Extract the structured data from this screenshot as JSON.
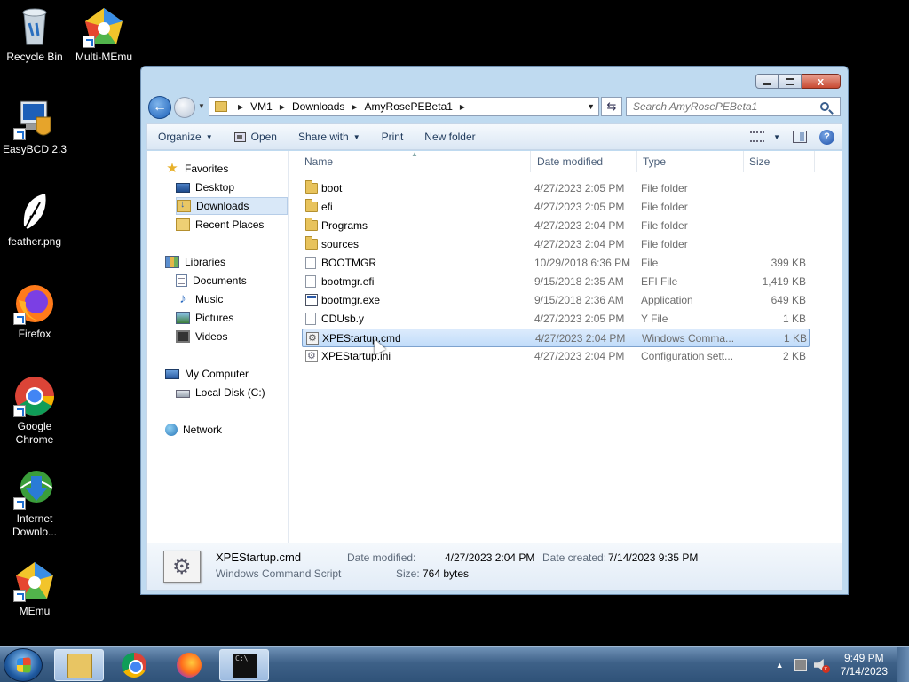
{
  "desktop": {
    "icons": [
      {
        "label": "Recycle Bin"
      },
      {
        "label": "Multi-MEmu"
      },
      {
        "label": "EasyBCD 2.3"
      },
      {
        "label": "feather.png"
      },
      {
        "label": "Firefox"
      },
      {
        "label": "Google\nChrome"
      },
      {
        "label": "Internet\nDownlo..."
      },
      {
        "label": "MEmu"
      }
    ]
  },
  "window": {
    "caption": {
      "min": "",
      "max": "",
      "close": "x"
    },
    "address": {
      "crumbs": [
        "VM1",
        "Downloads",
        "AmyRosePEBeta1"
      ]
    },
    "search": {
      "placeholder": "Search AmyRosePEBeta1"
    },
    "toolbar": {
      "organize": "Organize",
      "open": "Open",
      "share_with": "Share with",
      "print": "Print",
      "new_folder": "New folder"
    },
    "nav": {
      "favorites": "Favorites",
      "desktop": "Desktop",
      "downloads": "Downloads",
      "recent_places": "Recent Places",
      "libraries": "Libraries",
      "documents": "Documents",
      "music": "Music",
      "pictures": "Pictures",
      "videos": "Videos",
      "my_computer": "My Computer",
      "local_disk": "Local Disk (C:)",
      "network": "Network"
    },
    "columns": {
      "name": "Name",
      "date": "Date modified",
      "type": "Type",
      "size": "Size"
    },
    "files": [
      {
        "name": "boot",
        "date": "4/27/2023 2:05 PM",
        "type": "File folder",
        "size": "",
        "icon": "folder-icon"
      },
      {
        "name": "efi",
        "date": "4/27/2023 2:05 PM",
        "type": "File folder",
        "size": "",
        "icon": "folder-icon"
      },
      {
        "name": "Programs",
        "date": "4/27/2023 2:04 PM",
        "type": "File folder",
        "size": "",
        "icon": "folder-icon"
      },
      {
        "name": "sources",
        "date": "4/27/2023 2:04 PM",
        "type": "File folder",
        "size": "",
        "icon": "folder-icon"
      },
      {
        "name": "BOOTMGR",
        "date": "10/29/2018 6:36 PM",
        "type": "File",
        "size": "399 KB",
        "icon": "file-icon"
      },
      {
        "name": "bootmgr.efi",
        "date": "9/15/2018 2:35 AM",
        "type": "EFI File",
        "size": "1,419 KB",
        "icon": "file-icon"
      },
      {
        "name": "bootmgr.exe",
        "date": "9/15/2018 2:36 AM",
        "type": "Application",
        "size": "649 KB",
        "icon": "exe-icon"
      },
      {
        "name": "CDUsb.y",
        "date": "4/27/2023 2:05 PM",
        "type": "Y File",
        "size": "1 KB",
        "icon": "file-icon"
      },
      {
        "name": "XPEStartup.cmd",
        "date": "4/27/2023 2:04 PM",
        "type": "Windows Comma...",
        "size": "1 KB",
        "icon": "cmd-icon"
      },
      {
        "name": "XPEStartup.ini",
        "date": "4/27/2023 2:04 PM",
        "type": "Configuration sett...",
        "size": "2 KB",
        "icon": "ini-icon"
      }
    ],
    "details": {
      "name": "XPEStartup.cmd",
      "type": "Windows Command Script",
      "date_modified_label": "Date modified:",
      "date_modified": "4/27/2023 2:04 PM",
      "date_created_label": "Date created:",
      "date_created": "7/14/2023 9:35 PM",
      "size_label": "Size:",
      "size": "764 bytes"
    }
  },
  "taskbar": {
    "clock_time": "9:49 PM",
    "clock_date": "7/14/2023"
  }
}
